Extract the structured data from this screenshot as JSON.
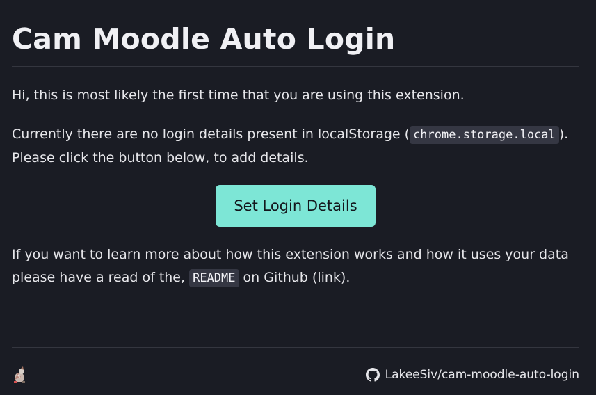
{
  "header": {
    "title": "Cam Moodle Auto Login"
  },
  "intro": {
    "text": "Hi, this is most likely the first time that you are using this extension."
  },
  "notice": {
    "before": "Currently there are no login details present in localStorage (",
    "code": "chrome.storage.local",
    "after": "). Please click the button below, to add details."
  },
  "actions": {
    "set_login_label": "Set Login Details"
  },
  "info": {
    "before": "If you want to learn more about how this extension works and how it uses your data please have a read of the, ",
    "code": "README",
    "after": " on Github (",
    "link_text": "link",
    "end": ")."
  },
  "footer": {
    "logo_icon": "mascot-logo",
    "github_icon": "github-icon",
    "repo_label": "LakeeSiv/cam-moodle-auto-login"
  },
  "colors": {
    "background": "#1a1c24",
    "accent_button": "#7de6d6",
    "code_bg": "#353743"
  }
}
